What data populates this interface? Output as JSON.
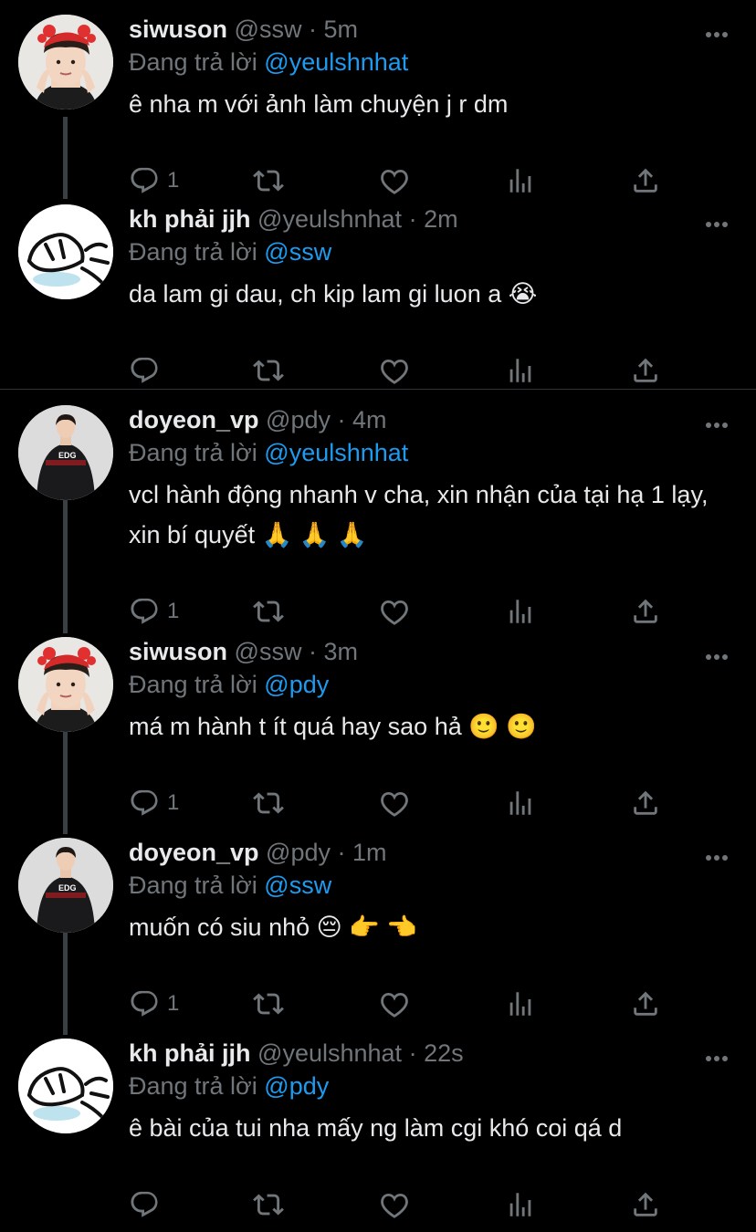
{
  "reply_prefix": "Đang trả lời",
  "colors": {
    "background": "#000000",
    "text": "#e7e9ea",
    "muted": "#71767b",
    "mention": "#1d9bf0",
    "thread_line": "#3a3f44",
    "divider": "#2f3336"
  },
  "tweets": [
    {
      "name": "siwuson",
      "handle": "@ssw",
      "time": "5m",
      "reply_to": "@yeulshnhat",
      "text": "ê nha m với ảnh làm chuyện j r dm",
      "reply_count": "1",
      "avatar": "avatar-siwuson"
    },
    {
      "name": "kh phải jjh",
      "handle": "@yeulshnhat",
      "time": "2m",
      "reply_to": "@ssw",
      "text": "da lam gi dau, ch kip lam gi luon a 😭",
      "reply_count": "",
      "avatar": "avatar-kh"
    },
    {
      "name": "doyeon_vp",
      "handle": "@pdy",
      "time": "4m",
      "reply_to": "@yeulshnhat",
      "text": "vcl hành động nhanh v cha, xin nhận của tại hạ 1 lạy, xin bí quyết 🙏 🙏 🙏",
      "reply_count": "1",
      "avatar": "avatar-doyeon"
    },
    {
      "name": "siwuson",
      "handle": "@ssw",
      "time": "3m",
      "reply_to": "@pdy",
      "text": "má m hành t ít quá hay sao hả 🙂 🙂",
      "reply_count": "1",
      "avatar": "avatar-siwuson"
    },
    {
      "name": "doyeon_vp",
      "handle": "@pdy",
      "time": "1m",
      "reply_to": "@ssw",
      "text": "muốn có siu nhỏ 😔 👉 👈",
      "reply_count": "1",
      "avatar": "avatar-doyeon"
    },
    {
      "name": "kh phải jjh",
      "handle": "@yeulshnhat",
      "time": "22s",
      "reply_to": "@pdy",
      "text": "ê bài của tui nha mấy ng làm cgi khó coi qá d",
      "reply_count": "",
      "avatar": "avatar-kh"
    }
  ]
}
